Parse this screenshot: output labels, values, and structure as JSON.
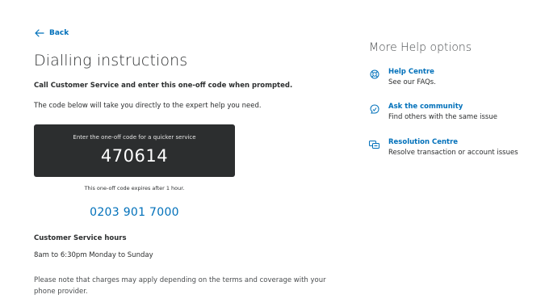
{
  "back": {
    "label": "Back"
  },
  "page": {
    "title": "Dialling instructions",
    "instruction_bold": "Call Customer Service and enter this one-off code when prompted.",
    "instruction_text": "The code below will take you directly to the expert help you need."
  },
  "code_box": {
    "caption": "Enter the one-off code for a quicker service",
    "code": "470614",
    "expiry": "This one-off code expires after 1 hour."
  },
  "phone": {
    "number": "0203 901 7000"
  },
  "hours": {
    "title": "Customer Service hours",
    "text": "8am to 6:30pm Monday to Sunday"
  },
  "charges_note": "Please note that charges may apply depending on the terms and coverage with your phone provider.",
  "help": {
    "title": "More Help options",
    "items": [
      {
        "label": "Help Centre",
        "desc": "See our FAQs.",
        "icon": "lifebuoy-icon"
      },
      {
        "label": "Ask the community",
        "desc": "Find others with the same issue",
        "icon": "community-icon"
      },
      {
        "label": "Resolution Centre",
        "desc": "Resolve transaction or account issues",
        "icon": "resolution-icon"
      }
    ]
  },
  "colors": {
    "link": "#0070ba",
    "text": "#2c2e2f",
    "code_box_bg": "#2c2e2f"
  }
}
